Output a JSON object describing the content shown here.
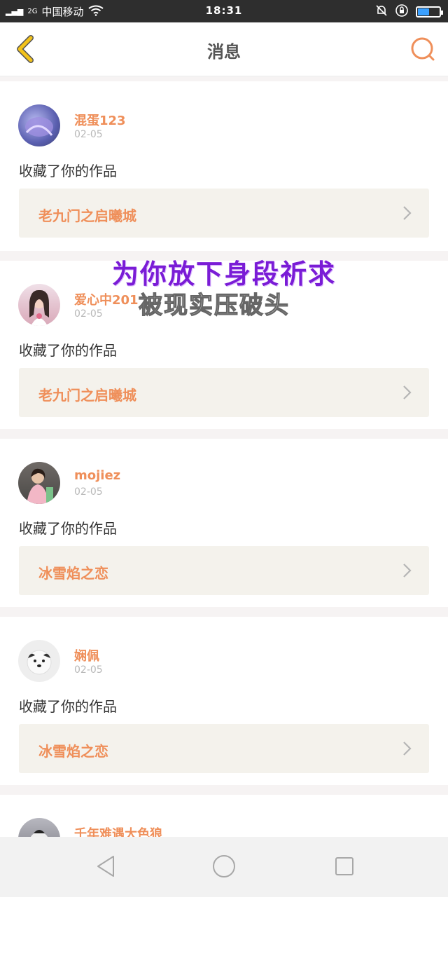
{
  "status_bar": {
    "carrier": "中国移动",
    "network": "2G",
    "time": "18:31",
    "battery_percent": 50
  },
  "header": {
    "title": "消息"
  },
  "notifications": [
    {
      "username": "混蛋123",
      "date": "02-05",
      "action": "收藏了你的作品",
      "work_title": "老九门之启曦城",
      "avatar_color": "#6e78c8"
    },
    {
      "username": "爱心中201",
      "date": "02-05",
      "action": "收藏了你的作品",
      "work_title": "老九门之启曦城",
      "avatar_color": "#d9a8b8"
    },
    {
      "username": "mojiez",
      "date": "02-05",
      "action": "收藏了你的作品",
      "work_title": "冰雪焰之恋",
      "avatar_color": "#7a6a5a"
    },
    {
      "username": "娴佩",
      "date": "02-05",
      "action": "收藏了你的作品",
      "work_title": "冰雪焰之恋",
      "avatar_color": "#e8e8e8"
    },
    {
      "username": "千年难遇大色狼",
      "date": "",
      "action": "",
      "work_title": "",
      "avatar_color": "#9a9aa4"
    }
  ],
  "overlay": {
    "line1": "为你放下身段祈求",
    "line2": "被现实压破头"
  },
  "colors": {
    "accent": "#ef8f5a",
    "back_icon": "#f2c21b"
  }
}
